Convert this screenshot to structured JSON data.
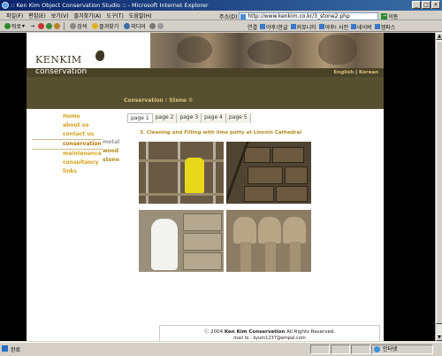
{
  "window": {
    "title": ":: Ken Kim Object Conservation Studio :: - Microsoft Internet Explorer",
    "controls": [
      "_",
      "□",
      "×"
    ]
  },
  "menubar": {
    "items": [
      "파일(F)",
      "편집(E)",
      "보기(V)",
      "즐겨찾기(A)",
      "도구(T)",
      "도움말(H)"
    ]
  },
  "address": {
    "label": "주소(D)",
    "url": "http://www.kenkim.co.kr/3_stone2.php",
    "go_label": "이동"
  },
  "toolbar": {
    "back": "뒤로",
    "search": "검색",
    "favorites": "즐겨찾기",
    "media": "미디어"
  },
  "links_bar": {
    "label": "연결",
    "items": [
      "야후!한글",
      "커뮤니티",
      "야후! 사전",
      "네이버",
      "엠파스"
    ]
  },
  "site": {
    "logo": {
      "word": "KENKIM",
      "sub": "conservation"
    },
    "lang": {
      "english": "English",
      "korean": "Korean",
      "sep": "|"
    },
    "breadcrumb": "Conservation : Stone ②",
    "nav": [
      {
        "label": "Home",
        "active": false
      },
      {
        "label": "about us",
        "active": false
      },
      {
        "label": "contact us",
        "active": false
      },
      {
        "label": "conservation",
        "active": true
      },
      {
        "label": "maintenance",
        "active": false
      },
      {
        "label": "consultancy",
        "active": false
      },
      {
        "label": "links",
        "active": false
      }
    ],
    "subnav": [
      {
        "label": "metal",
        "current": true
      },
      {
        "label": "wood",
        "current": false
      },
      {
        "label": "stone",
        "current": false
      }
    ],
    "pager": [
      "page 1",
      "page 2",
      "page 3",
      "page 4",
      "page 5"
    ],
    "article_title": "3. Cleaning and Filling with lime putty at Lincoln Cathedral",
    "footer": {
      "copyright_prefix": "ⓒ 2004 ",
      "copyright_name": "Ken Kim Conservation",
      "copyright_suffix": " All Rights Reserved.",
      "mail": "mail to : kyum1237@empal.com"
    }
  },
  "status": {
    "left": "완료",
    "zone": "인터넷"
  }
}
